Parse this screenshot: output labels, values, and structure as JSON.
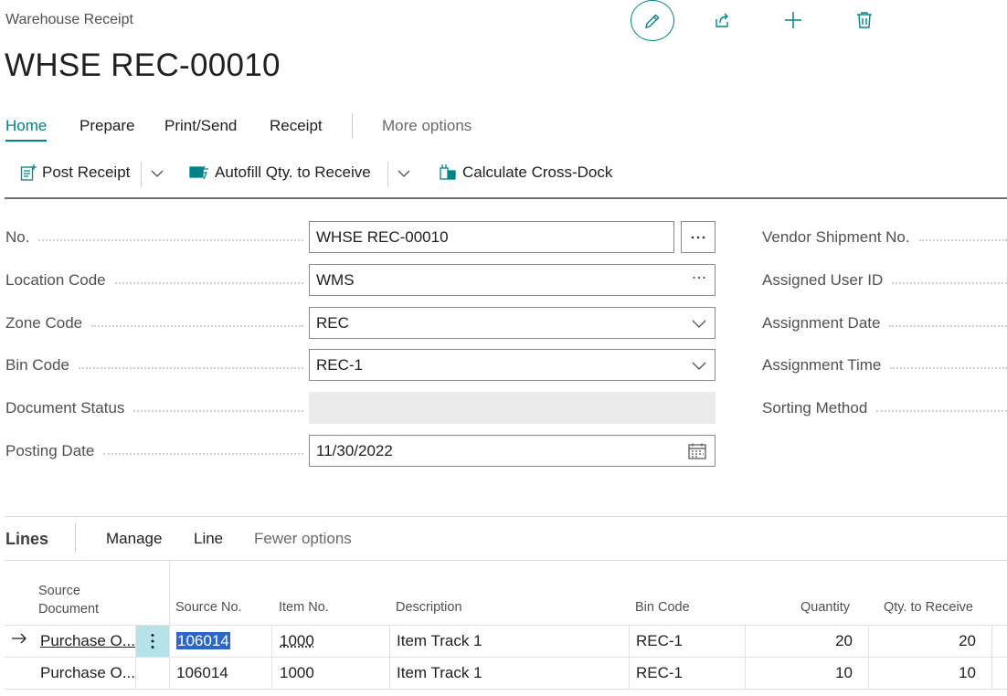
{
  "page": {
    "caption": "Warehouse Receipt",
    "title": "WHSE REC-00010"
  },
  "top_actions": [
    "edit-icon",
    "share-icon",
    "add-icon",
    "delete-icon"
  ],
  "menu": {
    "items": [
      "Home",
      "Prepare",
      "Print/Send",
      "Receipt"
    ],
    "more": "More options"
  },
  "actions": {
    "post_receipt": "Post Receipt",
    "autofill": "Autofill Qty. to Receive",
    "cross_dock": "Calculate Cross-Dock"
  },
  "fields": {
    "no": {
      "label": "No.",
      "value": "WHSE REC-00010"
    },
    "location_code": {
      "label": "Location Code",
      "value": "WMS"
    },
    "zone_code": {
      "label": "Zone Code",
      "value": "REC"
    },
    "bin_code": {
      "label": "Bin Code",
      "value": "REC-1"
    },
    "document_status": {
      "label": "Document Status",
      "value": ""
    },
    "posting_date": {
      "label": "Posting Date",
      "value": "11/30/2022"
    }
  },
  "right_fields": {
    "vendor_shipment_no": "Vendor Shipment No.",
    "assigned_user_id": "Assigned User ID",
    "assignment_date": "Assignment Date",
    "assignment_time": "Assignment Time",
    "sorting_method": "Sorting Method"
  },
  "lines": {
    "title": "Lines",
    "menu": [
      "Manage",
      "Line"
    ],
    "fewer": "Fewer options",
    "columns": {
      "source_document_1": "Source",
      "source_document_2": "Document",
      "source_no": "Source No.",
      "item_no": "Item No.",
      "description": "Description",
      "bin_code": "Bin Code",
      "quantity": "Quantity",
      "qty_to_receive": "Qty. to Receive"
    },
    "rows": [
      {
        "source_document": "Purchase O...",
        "source_no": "106014",
        "item_no": "1000",
        "description": "Item Track 1",
        "bin_code": "REC-1",
        "quantity": "20",
        "qty_to_receive": "20"
      },
      {
        "source_document": "Purchase O...",
        "source_no": "106014",
        "item_no": "1000",
        "description": "Item Track 1",
        "bin_code": "REC-1",
        "quantity": "10",
        "qty_to_receive": "10"
      }
    ]
  },
  "colors": {
    "accent": "#008489",
    "selection": "#2b66c8",
    "row_menu": "#b6e3ea"
  }
}
